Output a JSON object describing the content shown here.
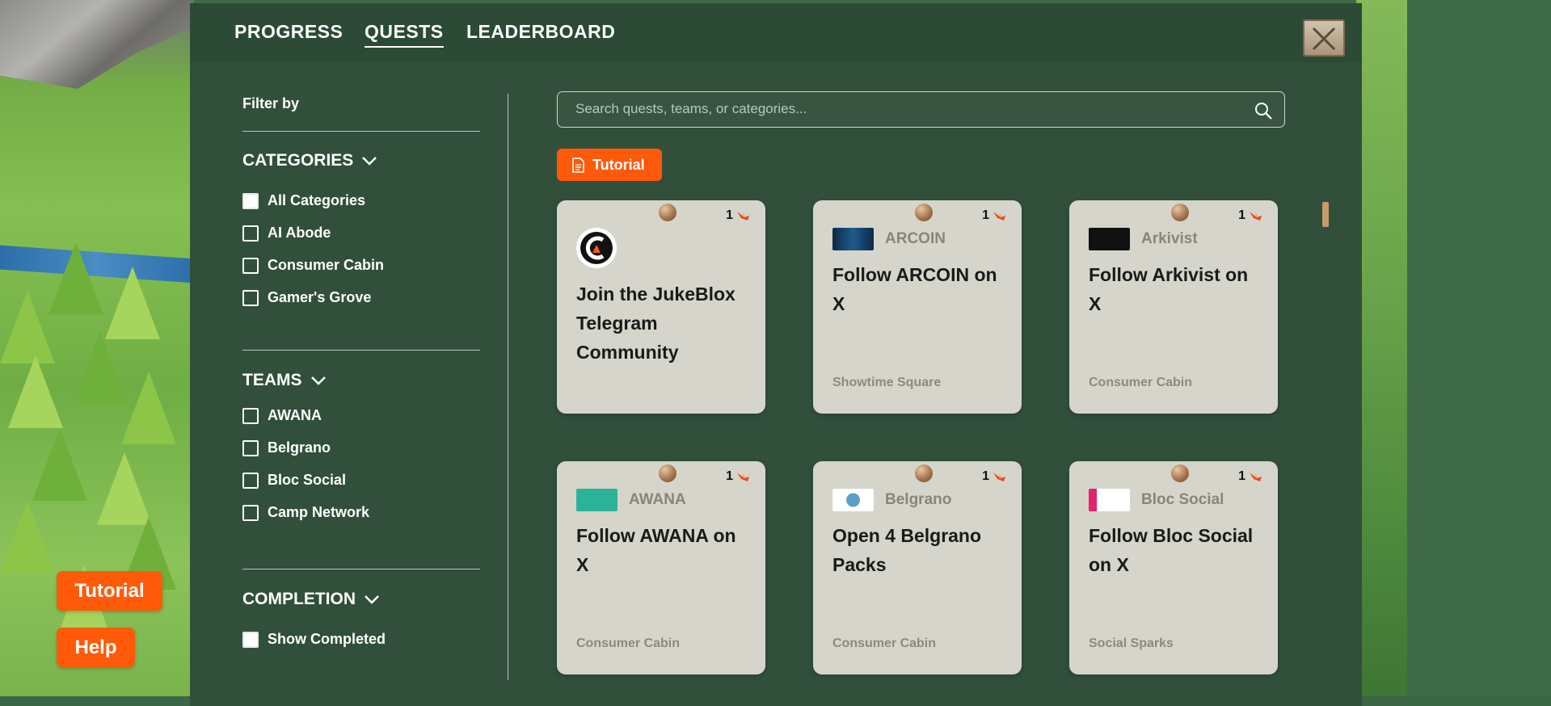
{
  "tabs": [
    {
      "label": "PROGRESS",
      "active": false
    },
    {
      "label": "QUESTS",
      "active": true
    },
    {
      "label": "LEADERBOARD",
      "active": false
    }
  ],
  "sidebar": {
    "filter_label": "Filter by",
    "categories": {
      "title": "CATEGORIES",
      "items": [
        "All Categories",
        "AI Abode",
        "Consumer Cabin",
        "Gamer's Grove"
      ]
    },
    "teams": {
      "title": "TEAMS",
      "items": [
        "AWANA",
        "Belgrano",
        "Bloc Social",
        "Camp Network"
      ]
    },
    "completion": {
      "title": "COMPLETION",
      "items": [
        "Show Completed"
      ]
    }
  },
  "search": {
    "placeholder": "Search quests, teams, or categories..."
  },
  "active_tag": {
    "label": "Tutorial",
    "color": "#ff5a0a"
  },
  "cards": [
    {
      "reward": "1",
      "team": "",
      "title": "Join the JukeBlox Telegram Community",
      "category": ""
    },
    {
      "reward": "1",
      "team": "ARCOIN",
      "title": "Follow ARCOIN on X",
      "category": "Showtime Square"
    },
    {
      "reward": "1",
      "team": "Arkivist",
      "title": "Follow Arkivist on X",
      "category": "Consumer Cabin"
    },
    {
      "reward": "1",
      "team": "AWANA",
      "title": "Follow AWANA on X",
      "category": "Consumer Cabin"
    },
    {
      "reward": "1",
      "team": "Belgrano",
      "title": "Open 4 Belgrano Packs",
      "category": "Consumer Cabin"
    },
    {
      "reward": "1",
      "team": "Bloc Social",
      "title": "Follow Bloc Social on X",
      "category": "Social Sparks"
    }
  ],
  "floating": {
    "tutorial": "Tutorial",
    "help": "Help"
  },
  "colors": {
    "accent": "#ff5a0a",
    "card_bg": "#d6d5cb",
    "panel": "#314f3b"
  },
  "icons": [
    "close-icon",
    "chevron-down-icon",
    "search-icon",
    "document-icon",
    "coin-icon",
    "flame-icon",
    "jukeblox-logo-icon"
  ]
}
